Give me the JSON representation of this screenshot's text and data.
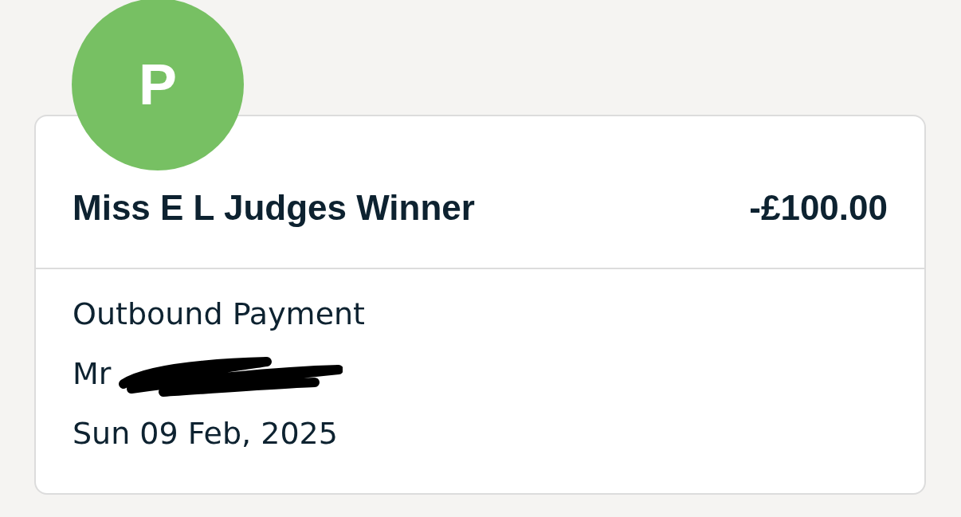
{
  "transaction": {
    "avatar_initial": "P",
    "payee": "Miss E L Judges Winner",
    "amount": "-£100.00",
    "type": "Outbound Payment",
    "recipient": {
      "text": "Mr",
      "redacted": true
    },
    "date": "Sun 09 Feb, 2025"
  }
}
